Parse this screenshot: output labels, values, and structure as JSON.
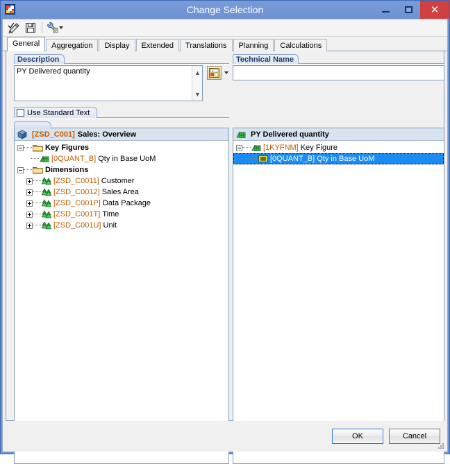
{
  "window": {
    "title": "Change Selection",
    "icon": "app-cube-icon",
    "caption_buttons": {
      "minimize": "minimize-icon",
      "maximize": "maximize-icon",
      "close": "close-icon"
    }
  },
  "toolbar": {
    "buttons": [
      {
        "name": "check-syntax-button",
        "icon": "pencil-check-icon",
        "label": ""
      },
      {
        "name": "save-button",
        "icon": "floppy-disk-icon",
        "label": ""
      },
      {
        "name": "tools-button",
        "icon": "wrench-icon",
        "label": "",
        "has_dropdown": true
      }
    ]
  },
  "tabs": [
    {
      "label": "General",
      "active": true
    },
    {
      "label": "Aggregation",
      "active": false
    },
    {
      "label": "Display",
      "active": false
    },
    {
      "label": "Extended",
      "active": false
    },
    {
      "label": "Translations",
      "active": false
    },
    {
      "label": "Planning",
      "active": false
    },
    {
      "label": "Calculations",
      "active": false
    }
  ],
  "general": {
    "description_group": {
      "caption": "Description",
      "value": "PY Delivered quantity",
      "scroll_up": "▲",
      "scroll_down": "▼",
      "variable_button": {
        "name": "insert-variable-button",
        "icon": "variable-formula-icon",
        "dropdown_icon": "chevron-down-icon"
      }
    },
    "technical_name_group": {
      "caption": "Technical Name",
      "value": "",
      "placeholder": ""
    },
    "use_standard_text": {
      "label": "Use Standard Text",
      "checked": false
    }
  },
  "left_tree": {
    "header": {
      "icon": "infocube-icon",
      "id": "[ZSD_C001]",
      "text": "Sales: Overview"
    },
    "nodes": [
      {
        "level": 0,
        "expander": "minus",
        "icon": "folder-icon",
        "id": "",
        "desc": "Key Figures",
        "bold": true,
        "selected": false
      },
      {
        "level": 1,
        "expander": "none",
        "icon": "key-figure-icon",
        "id": "[0QUANT_B]",
        "desc": "Qty in Base UoM",
        "bold": false,
        "selected": false
      },
      {
        "level": 0,
        "expander": "minus",
        "icon": "folder-icon",
        "id": "",
        "desc": "Dimensions",
        "bold": true,
        "selected": false
      },
      {
        "level": 1,
        "expander": "plus",
        "icon": "dimension-icon",
        "id": "[ZSD_C0011]",
        "desc": "Customer",
        "bold": false,
        "selected": false
      },
      {
        "level": 1,
        "expander": "plus",
        "icon": "dimension-icon",
        "id": "[ZSD_C0012]",
        "desc": "Sales Area",
        "bold": false,
        "selected": false
      },
      {
        "level": 1,
        "expander": "plus",
        "icon": "dimension-icon",
        "id": "[ZSD_C001P]",
        "desc": "Data Package",
        "bold": false,
        "selected": false
      },
      {
        "level": 1,
        "expander": "plus",
        "icon": "dimension-icon",
        "id": "[ZSD_C001T]",
        "desc": "Time",
        "bold": false,
        "selected": false
      },
      {
        "level": 1,
        "expander": "plus",
        "icon": "dimension-icon",
        "id": "[ZSD_C001U]",
        "desc": "Unit",
        "bold": false,
        "selected": false
      }
    ]
  },
  "right_tree": {
    "header": {
      "icon": "key-figure-icon",
      "id": "",
      "text": "PY Delivered quantity"
    },
    "nodes": [
      {
        "level": 0,
        "expander": "minus",
        "icon": "key-figure-icon",
        "id": "[1KYFNM]",
        "desc": "Key Figure",
        "bold": false,
        "selected": false
      },
      {
        "level": 1,
        "expander": "none",
        "icon": "equals-icon",
        "id": "[0QUANT_B]",
        "desc": "Qty in Base UoM",
        "bold": false,
        "selected": true
      }
    ]
  },
  "footer": {
    "ok_label": "OK",
    "cancel_label": "Cancel",
    "resize_grip": "resize-grip-icon"
  },
  "colors": {
    "title_bar": "#6d91d2",
    "close_button": "#cf4040",
    "selection": "#1b8cf5",
    "technical_id_text": "#c05a00",
    "group_caption_text": "#1f3864"
  }
}
